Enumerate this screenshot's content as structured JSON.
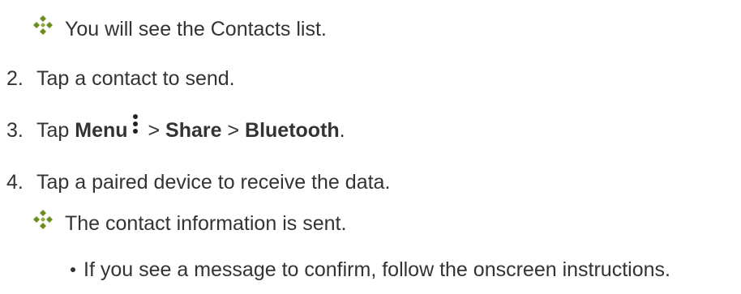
{
  "result_1": {
    "icon": "diamond-arrow-bullet-icon",
    "text": "You will see the Contacts list."
  },
  "steps": [
    {
      "number": "2.",
      "text": "Tap a contact to send."
    },
    {
      "number": "3.",
      "prefix": "Tap ",
      "menu": "Menu",
      "menu_icon": "vertical-ellipsis-icon",
      "sep1": " > ",
      "share": "Share",
      "sep2": " > ",
      "bluetooth": "Bluetooth",
      "suffix": "."
    },
    {
      "number": "4.",
      "text": "Tap a paired device to receive the data."
    }
  ],
  "result_2": {
    "icon": "diamond-arrow-bullet-icon",
    "text": "The contact information is sent."
  },
  "note": {
    "text": "If you see a message to confirm, follow the onscreen instructions."
  }
}
